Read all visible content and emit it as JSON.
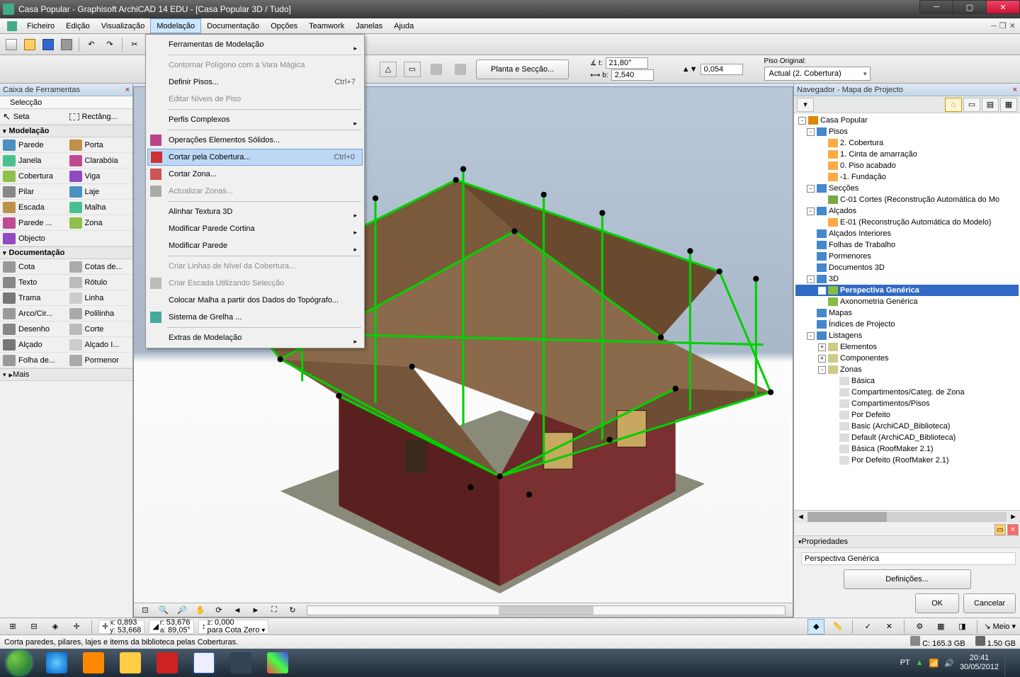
{
  "title": "Casa Popular - Graphisoft ArchiCAD 14 EDU - [Casa Popular 3D / Tudo]",
  "menu": [
    "Ficheiro",
    "Edição",
    "Visualização",
    "Modelação",
    "Documentação",
    "Opções",
    "Teamwork",
    "Janelas",
    "Ajuda"
  ],
  "menu_active_index": 3,
  "dropdown": [
    {
      "label": "Ferramentas de Modelação",
      "sub": true
    },
    {
      "sep": true
    },
    {
      "label": "Contornar Polígono com a Vara Mágica",
      "disabled": true
    },
    {
      "label": "Definir Pisos...",
      "shortcut": "Ctrl+7"
    },
    {
      "label": "Editar Níveis de Piso",
      "disabled": true
    },
    {
      "sep": true
    },
    {
      "label": "Perfis Complexos",
      "sub": true
    },
    {
      "sep": true
    },
    {
      "label": "Operações Elementos Sólidos...",
      "icon": "#b48"
    },
    {
      "label": "Cortar pela Cobertura...",
      "shortcut": "Ctrl+0",
      "icon": "#c33",
      "highlight": true
    },
    {
      "label": "Cortar Zona...",
      "icon": "#c55"
    },
    {
      "label": "Actualizar Zonas...",
      "disabled": true,
      "icon": "#aaa"
    },
    {
      "sep": true
    },
    {
      "label": "Alinhar Textura 3D",
      "sub": true
    },
    {
      "label": "Modificar Parede Cortina",
      "sub": true
    },
    {
      "label": "Modificar Parede",
      "sub": true
    },
    {
      "sep": true
    },
    {
      "label": "Criar Linhas de Nível da Cobertura...",
      "disabled": true
    },
    {
      "label": "Criar Escada Utilizando Selecção",
      "disabled": true,
      "icon": "#bbb"
    },
    {
      "label": "Colocar Malha a partir dos Dados do Topógrafo..."
    },
    {
      "label": "Sistema de Grelha ...",
      "icon": "#4a9"
    },
    {
      "sep": true
    },
    {
      "label": "Extras de Modelação",
      "sub": true
    }
  ],
  "toolbox": {
    "title": "Caixa de Ferramentas",
    "select_label": "Selecção",
    "arrow": "Seta",
    "marquee": "Rectâng...",
    "cat_model": "Modelação",
    "model_tools": [
      [
        "Parede",
        "Porta"
      ],
      [
        "Janela",
        "Clarabóia"
      ],
      [
        "Cobertura",
        "Viga"
      ],
      [
        "Pilar",
        "Laje"
      ],
      [
        "Escada",
        "Malha"
      ],
      [
        "Parede ...",
        "Zona"
      ],
      [
        "Objecto",
        ""
      ]
    ],
    "cat_doc": "Documentação",
    "doc_tools": [
      [
        "Cota",
        "Cotas de..."
      ],
      [
        "Texto",
        "Rótulo"
      ],
      [
        "Trama",
        "Linha"
      ],
      [
        "Arco/Cir...",
        "Polilinha"
      ],
      [
        "Desenho",
        "Corte"
      ],
      [
        "Alçado",
        "Alçado I..."
      ],
      [
        "Folha de...",
        "Pormenor"
      ]
    ],
    "more": "Mais"
  },
  "info_row": {
    "plan_btn": "Planta e Secção...",
    "angle_t": "21,80°",
    "dist_b": "2,540",
    "offset": "0,054",
    "floor_lbl": "Piso Original:",
    "floor_combo": "Actual (2. Cobertura)"
  },
  "navigator": {
    "title": "Navegador - Mapa de Projecto",
    "tree": [
      {
        "l": "Casa Popular",
        "ind": 0,
        "tog": "-",
        "ico": "#d80"
      },
      {
        "l": "Pisos",
        "ind": 1,
        "tog": "-",
        "ico": "#48c"
      },
      {
        "l": "2. Cobertura",
        "ind": 2,
        "ico": "#fa4"
      },
      {
        "l": "1. Cinta de amarração",
        "ind": 2,
        "ico": "#fa4"
      },
      {
        "l": "0. Piso acabado",
        "ind": 2,
        "ico": "#fa4"
      },
      {
        "l": "-1. Fundação",
        "ind": 2,
        "ico": "#fa4"
      },
      {
        "l": "Secções",
        "ind": 1,
        "tog": "-",
        "ico": "#48c"
      },
      {
        "l": "C-01 Cortes (Reconstrução Automática do Mo",
        "ind": 2,
        "ico": "#7a4"
      },
      {
        "l": "Alçados",
        "ind": 1,
        "tog": "-",
        "ico": "#48c"
      },
      {
        "l": "E-01 (Reconstrução Automática do Modelo)",
        "ind": 2,
        "ico": "#fa4"
      },
      {
        "l": "Alçados Interiores",
        "ind": 1,
        "ico": "#48c"
      },
      {
        "l": "Folhas de Trabalho",
        "ind": 1,
        "ico": "#48c"
      },
      {
        "l": "Pormenores",
        "ind": 1,
        "ico": "#48c"
      },
      {
        "l": "Documentos 3D",
        "ind": 1,
        "ico": "#48c"
      },
      {
        "l": "3D",
        "ind": 1,
        "tog": "-",
        "ico": "#48c"
      },
      {
        "l": "Perspectiva Genérica",
        "ind": 2,
        "ico": "#8b4",
        "sel": true,
        "bold": true
      },
      {
        "l": "Axonometria Genérica",
        "ind": 2,
        "ico": "#8b4"
      },
      {
        "l": "Mapas",
        "ind": 1,
        "ico": "#48c"
      },
      {
        "l": "Índices de Projecto",
        "ind": 1,
        "ico": "#48c"
      },
      {
        "l": "Listagens",
        "ind": 1,
        "tog": "-",
        "ico": "#48c"
      },
      {
        "l": "Elementos",
        "ind": 2,
        "tog": "+",
        "ico": "#cc8"
      },
      {
        "l": "Componentes",
        "ind": 2,
        "tog": "+",
        "ico": "#cc8"
      },
      {
        "l": "Zonas",
        "ind": 2,
        "tog": "-",
        "ico": "#cc8"
      },
      {
        "l": "Básica",
        "ind": 3,
        "ico": "#ddd"
      },
      {
        "l": "Compartimentos/Categ. de Zona",
        "ind": 3,
        "ico": "#ddd"
      },
      {
        "l": "Compartimentos/Pisos",
        "ind": 3,
        "ico": "#ddd"
      },
      {
        "l": "Por Defeito",
        "ind": 3,
        "ico": "#ddd"
      },
      {
        "l": "Basic (ArchiCAD_Biblioteca)",
        "ind": 3,
        "ico": "#ddd"
      },
      {
        "l": "Default (ArchiCAD_Biblioteca)",
        "ind": 3,
        "ico": "#ddd"
      },
      {
        "l": "Básica (RoofMaker 2.1)",
        "ind": 3,
        "ico": "#ddd"
      },
      {
        "l": "Por Defeito (RoofMaker 2.1)",
        "ind": 3,
        "ico": "#ddd"
      }
    ],
    "props_title": "Propriedades",
    "props_name": "Perspectiva Genérica",
    "props_btn": "Definições...",
    "ok": "OK",
    "cancel": "Cancelar"
  },
  "status": {
    "x": "0,893",
    "y": "53,668",
    "r": "53,676",
    "a": "89,05°",
    "z": "0,000",
    "z_lbl": "para Cota Zero",
    "meio": "Meio"
  },
  "hint": "Corta paredes, pilares, lajes e items da biblioteca pelas Coberturas.",
  "disks": {
    "c": "C: 165.3 GB",
    "ext": "1.50 GB"
  },
  "tray": {
    "lang": "PT",
    "time": "20:41",
    "date": "30/05/2012"
  }
}
